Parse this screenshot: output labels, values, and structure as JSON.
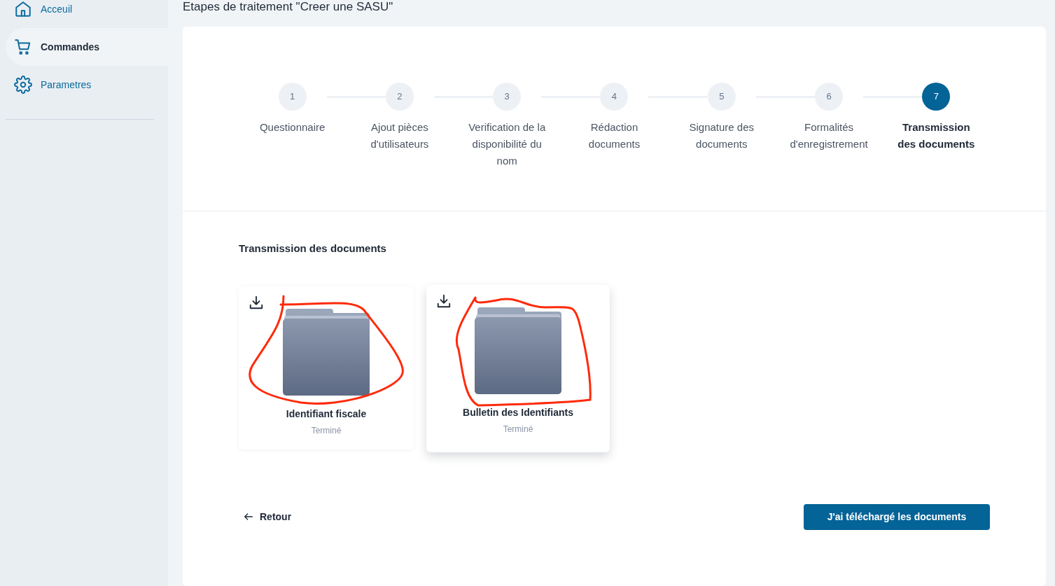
{
  "sidebar": {
    "items": [
      {
        "label": "Acceuil",
        "kind": "home",
        "selected": false
      },
      {
        "label": "Commandes",
        "kind": "cart",
        "selected": true
      },
      {
        "label": "Parametres",
        "kind": "gear",
        "selected": false
      }
    ]
  },
  "page_title": "Etapes de traitement \"Creer une SASU\"",
  "stepper": [
    {
      "number": "1",
      "label": "Questionnaire",
      "selected": false
    },
    {
      "number": "2",
      "label": "Ajout pièces d'utilisateurs",
      "selected": false
    },
    {
      "number": "3",
      "label": "Verification de la disponibilité du nom",
      "selected": false
    },
    {
      "number": "4",
      "label": "Rédaction documents",
      "selected": false
    },
    {
      "number": "5",
      "label": "Signature des documents",
      "selected": false
    },
    {
      "number": "6",
      "label": "Formalités d'enregistrement",
      "selected": false
    },
    {
      "number": "7",
      "label": "Transmission des documents",
      "selected": true
    }
  ],
  "section_title": "Transmission des documents",
  "documents": [
    {
      "name": "Identifiant fiscale",
      "status": "Terminé",
      "hovered": false
    },
    {
      "name": "Bulletin des Identifiants",
      "status": "Terminé",
      "hovered": true
    }
  ],
  "back_button": "Retour",
  "confirm_button": "J'ai téléchargé les documents"
}
